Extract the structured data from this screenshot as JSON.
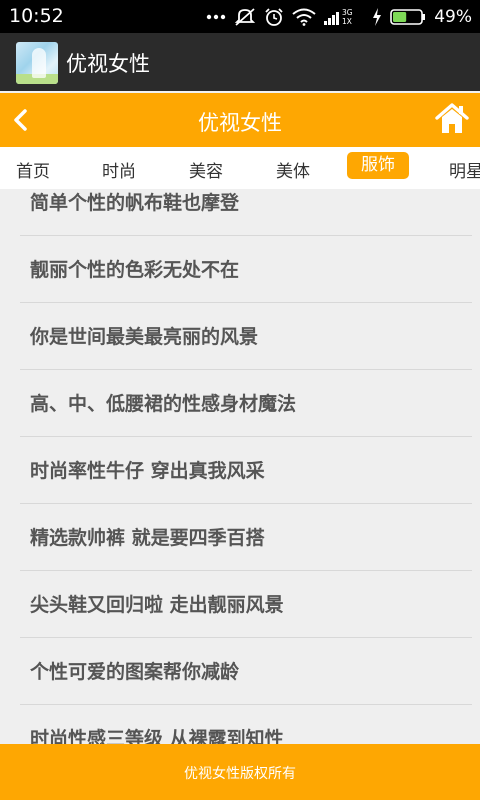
{
  "status_bar": {
    "time": "10:52",
    "network_label_top": "3G",
    "network_label_bottom": "1X",
    "battery_percent": "49%",
    "icons": [
      "more-dots-icon",
      "mute-icon",
      "alarm-icon",
      "wifi-icon",
      "signal-icon",
      "charging-icon",
      "battery-icon"
    ]
  },
  "app_bar": {
    "title": "优视女性"
  },
  "header": {
    "title": "优视女性",
    "back_icon": "chevron-left-icon",
    "home_icon": "home-icon"
  },
  "tabs": [
    {
      "label": "首页",
      "active": false
    },
    {
      "label": "时尚",
      "active": false
    },
    {
      "label": "美容",
      "active": false
    },
    {
      "label": "美体",
      "active": false
    },
    {
      "label": "服饰",
      "active": true
    },
    {
      "label": "明星",
      "active": false
    }
  ],
  "articles": [
    "简单个性的帆布鞋也摩登",
    "靓丽个性的色彩无处不在",
    "你是世间最美最亮丽的风景",
    "高、中、低腰裙的性感身材魔法",
    "时尚率性牛仔 穿出真我风采",
    "精选款帅裤 就是要四季百搭",
    "尖头鞋又回归啦 走出靓丽风景",
    "个性可爱的图案帮你减龄",
    "时尚性感三等级 从裸露到知性"
  ],
  "footer": {
    "text": "优视女性版权所有"
  },
  "colors": {
    "accent": "#fea702",
    "app_bar": "#2b2b2b",
    "list_bg": "#efefef",
    "item_text": "#555555"
  }
}
